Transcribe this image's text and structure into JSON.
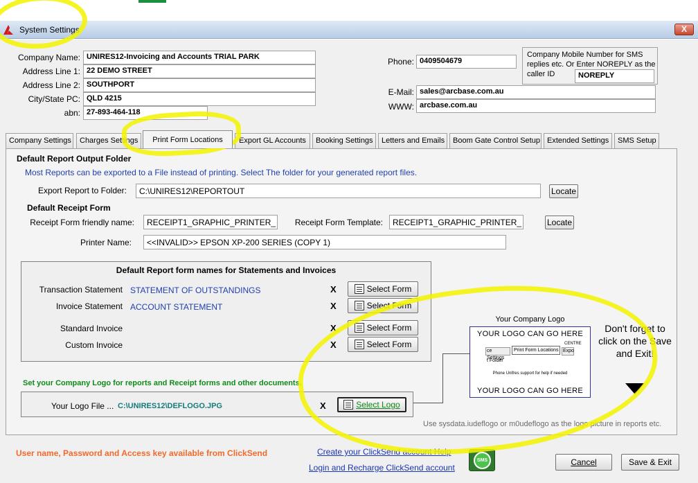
{
  "window": {
    "title": "System Settings",
    "close_label": "X"
  },
  "company": {
    "name_label": "Company Name:",
    "name_value": "UNIRES12-Invoicing and Accounts TRIAL PARK",
    "address1_label": "Address Line 1:",
    "address1_value": "22 DEMO STREET",
    "address2_label": "Address Line 2:",
    "address2_value": "SOUTHPORT",
    "city_label": "City/State PC:",
    "city_value": "QLD 4215",
    "abn_label": "abn:",
    "abn_value": "27-893-464-118"
  },
  "contact": {
    "phone_label": "Phone:",
    "phone_value": "0409504679",
    "mobile_note": "Company Mobile Number for SMS replies etc. Or Enter NOREPLY as the caller ID",
    "mobile_value": "NOREPLY",
    "email_label": "E-Mail:",
    "email_value": "sales@arcbase.com.au",
    "www_label": "WWW:",
    "www_value": "arcbase.com.au"
  },
  "tabs": [
    {
      "label": "Company Settings"
    },
    {
      "label": "Charges Settings"
    },
    {
      "label": "Print Form Locations"
    },
    {
      "label": "Export GL Accounts"
    },
    {
      "label": "Booking Settings"
    },
    {
      "label": "Letters and Emails"
    },
    {
      "label": "Boom Gate Control Setup"
    },
    {
      "label": "Extended Settings"
    },
    {
      "label": "SMS Setup"
    }
  ],
  "print_forms": {
    "output_title": "Default Report Output Folder",
    "output_desc": "Most Reports can be exported to a File instead of printing. Select The folder for your generated report files.",
    "export_label": "Export Report to Folder:",
    "export_value": "C:\\UNIRES12\\REPORTOUT",
    "locate_label": "Locate",
    "receipt_title": "Default Receipt Form",
    "receipt_name_label": "Receipt Form friendly name:",
    "receipt_name_value": "RECEIPT1_GRAPHIC_PRINTER_",
    "receipt_template_label": "Receipt Form Template:",
    "receipt_template_value": "RECEIPT1_GRAPHIC_PRINTER_",
    "printer_label": "Printer Name:",
    "printer_value": "<<INVALID>> EPSON XP-200 SERIES (COPY 1)",
    "group_title": "Default Report form names for Statements and Invoices",
    "rows": [
      {
        "label": "Transaction Statement",
        "value": "STATEMENT OF OUTSTANDINGS",
        "x": "X",
        "button": "Select Form"
      },
      {
        "label": "Invoice Statement",
        "value": "ACCOUNT STATEMENT",
        "x": "X",
        "button": "Select Form"
      },
      {
        "label": "Standard Invoice",
        "value": "",
        "x": "X",
        "button": "Select Form"
      },
      {
        "label": "Custom Invoice",
        "value": "",
        "x": "X",
        "button": "Select Form"
      }
    ],
    "logo_section_title": "Set your Company Logo for reports and Receipt forms and other documents.",
    "logo_file_label": "Your Logo File ...",
    "logo_file_value": "C:\\UNIRES12\\DEFLOGO.JPG",
    "logo_x": "X",
    "select_logo_label": "Select Logo",
    "logo_preview_title": "Your Company Logo",
    "logo_preview_top": "YOUR LOGO CAN GO HERE",
    "logo_preview_bottom": "YOUR LOGO CAN GO HERE",
    "logo_preview_tab1": "ce Settings",
    "logo_preview_tab2": "Print Form Locations",
    "logo_preview_tab3": "Expo",
    "logo_preview_folder": "t Folder",
    "logo_preview_note": "Phone Unifres support for help if needed",
    "logo_preview_corner": "CENTRE",
    "reminder": "Don't forget to click on the Save and Exit!",
    "sysdata_note": "Use sysdata.iudeflogo or m0udeflogo as the logo picture in reports etc."
  },
  "footer": {
    "clicksend_note": "User name, Password and Access key available from ClickSend",
    "create_link": "Create your ClickSend account Help",
    "login_link": "Login and Recharge ClickSend account",
    "sms_icon_label": "SMS",
    "cancel_label": "Cancel",
    "save_label": "Save & Exit"
  },
  "colors": {
    "highlight": "#f3f300",
    "link": "#1a35b5",
    "orange": "#f26a2a",
    "green_title": "#118a1a"
  }
}
